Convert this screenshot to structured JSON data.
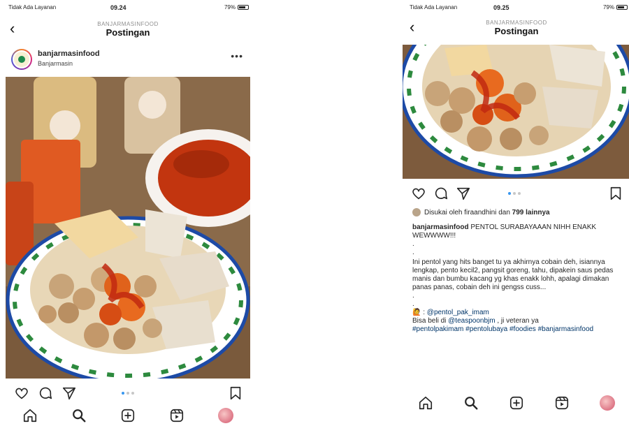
{
  "left_screen": {
    "status": {
      "carrier": "Tidak Ada Layanan",
      "time": "09.24",
      "battery": "79%"
    },
    "header": {
      "subtitle": "BANJARMASINFOOD",
      "title": "Postingan"
    },
    "post": {
      "username": "banjarmasinfood",
      "location": "Banjarmasin"
    }
  },
  "right_screen": {
    "status": {
      "carrier": "Tidak Ada Layanan",
      "time": "09.25",
      "battery": "79%"
    },
    "header": {
      "subtitle": "BANJARMASINFOOD",
      "title": "Postingan"
    },
    "likes": {
      "prefix": "Disukai oleh",
      "user": "firaandhini",
      "joiner": "dan",
      "count": "799 lainnya"
    },
    "caption": {
      "username": "banjarmasinfood",
      "headline": "PENTOL SURABAYAAAN NIHH ENAKK WEWWWW!!!",
      "sep1": ".",
      "sep2": ".",
      "body": "Ini pentol yang hits banget tu ya akhirnya cobain deh, isiannya lengkap, pento kecil2, pangsit goreng, tahu, dipakein saus pedas manis dan bumbu kacang yg khas enakk lohh, apalagi dimakan panas panas, cobain deh ini gengss cuss...",
      "sep3": ".",
      "sep4": ".",
      "credit_prefix": ": ",
      "credit_handle": "@pentol_pak_imam",
      "buy_prefix": "Bisa beli di",
      "buy_handle": "@teaspoonbjm",
      "buy_suffix": ", ji veteran ya",
      "hashtags": "#pentolpakimam #pentolubaya #foodies #banjarmasinfood"
    }
  },
  "colors": {
    "accent": "#3897f0",
    "text": "#262626",
    "muted": "#8e8e8e",
    "link": "#003569"
  },
  "icons": [
    "back-chevron-icon",
    "more-icon",
    "heart-icon",
    "comment-icon",
    "share-icon",
    "bookmark-icon",
    "home-icon",
    "search-icon",
    "create-icon",
    "reels-icon",
    "profile-avatar"
  ]
}
